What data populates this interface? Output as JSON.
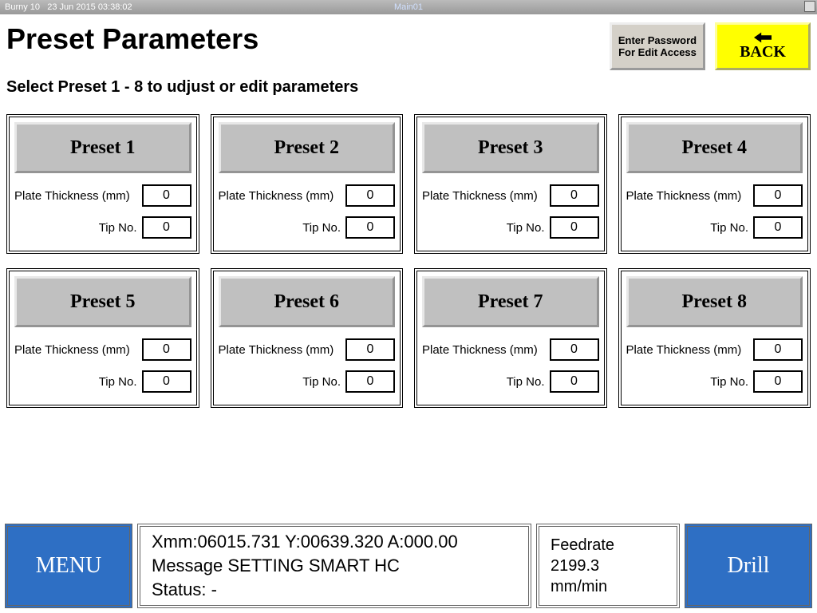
{
  "titlebar": {
    "app": "Burny 10",
    "datetime": "23 Jun 2015  03:38:02",
    "center": "Main01"
  },
  "header": {
    "title": "Preset Parameters",
    "subtitle": "Select Preset 1 - 8 to udjust or edit parameters",
    "password_line1": "Enter Password",
    "password_line2": "For Edit Access",
    "back_label": "BACK"
  },
  "labels": {
    "plate_thickness": "Plate Thickness (mm)",
    "tip_no": "Tip No."
  },
  "presets": [
    {
      "name": "Preset 1",
      "plate": "0",
      "tip": "0"
    },
    {
      "name": "Preset 2",
      "plate": "0",
      "tip": "0"
    },
    {
      "name": "Preset 3",
      "plate": "0",
      "tip": "0"
    },
    {
      "name": "Preset 4",
      "plate": "0",
      "tip": "0"
    },
    {
      "name": "Preset 5",
      "plate": "0",
      "tip": "0"
    },
    {
      "name": "Preset 6",
      "plate": "0",
      "tip": "0"
    },
    {
      "name": "Preset 7",
      "plate": "0",
      "tip": "0"
    },
    {
      "name": "Preset 8",
      "plate": "0",
      "tip": "0"
    }
  ],
  "footer": {
    "menu": "MENU",
    "coords": "Xmm:06015.731 Y:00639.320 A:000.00",
    "message": "Message SETTING SMART HC",
    "status": "Status:  -",
    "feedrate_label": "Feedrate",
    "feedrate_value": "2199.3",
    "feedrate_unit": "mm/min",
    "drill": "Drill"
  }
}
